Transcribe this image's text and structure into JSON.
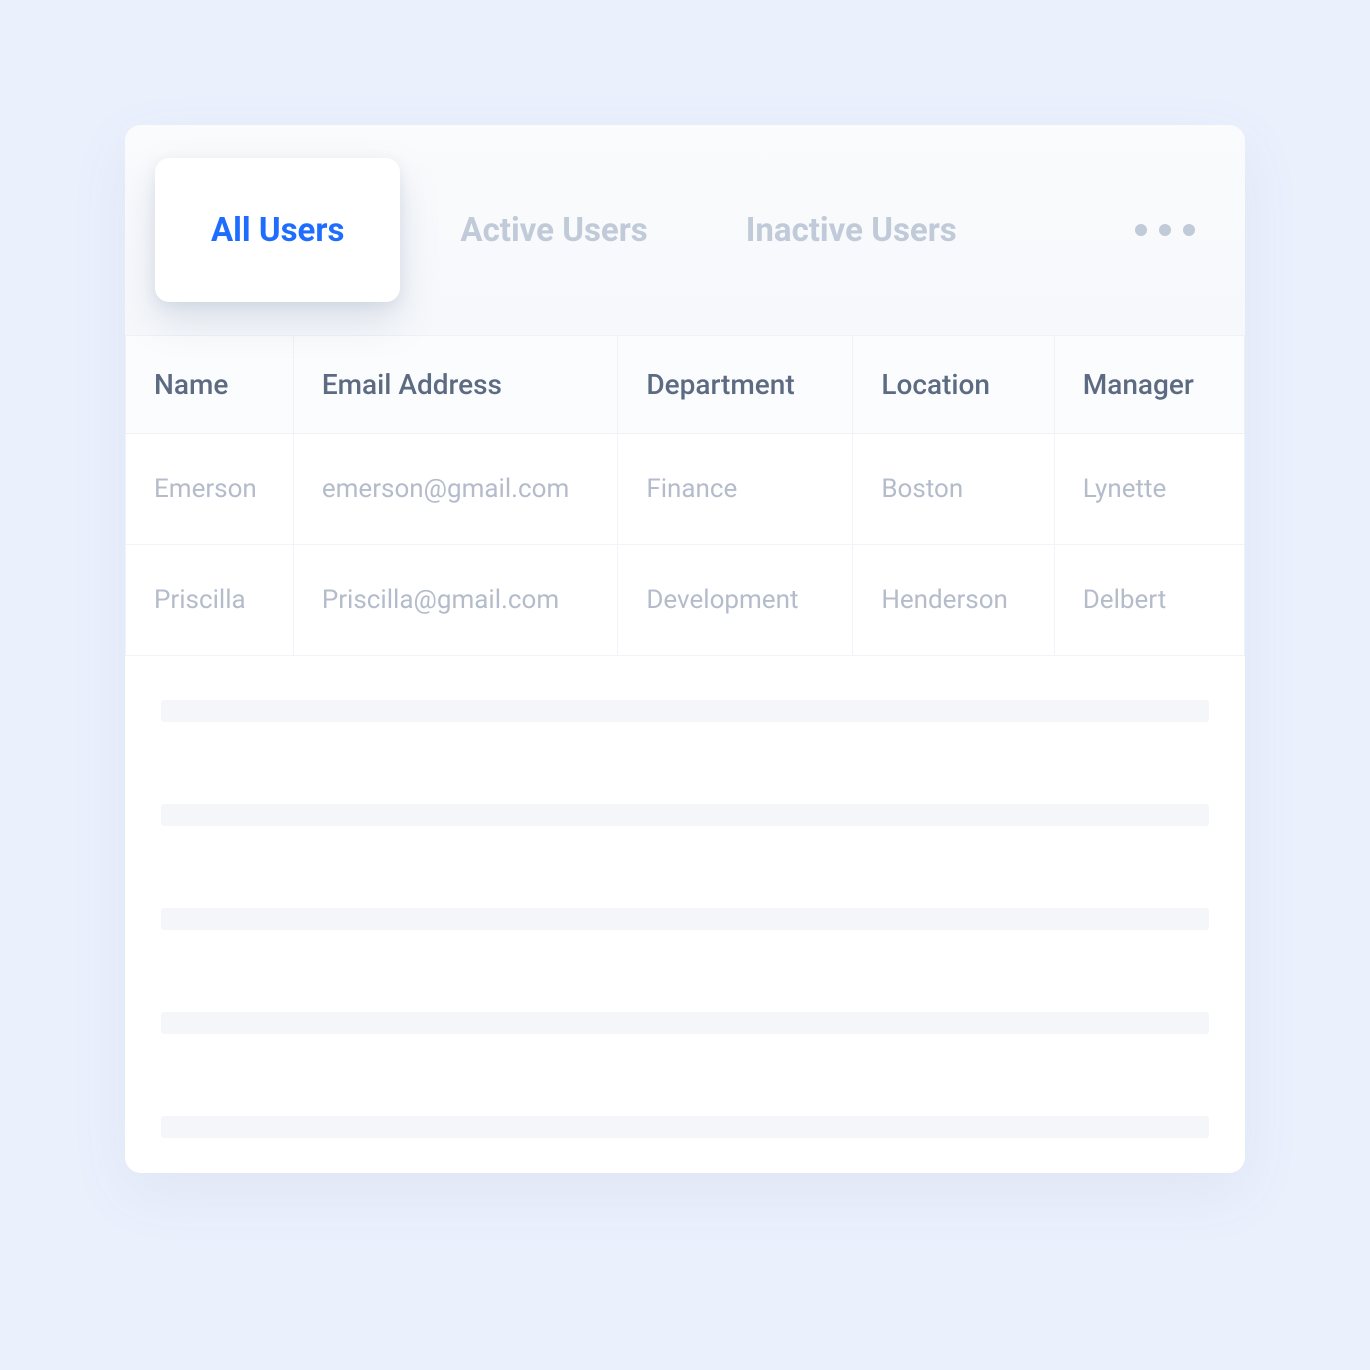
{
  "tabs": {
    "active": "All Users",
    "inactive1": "Active Users",
    "inactive2": "Inactive Users"
  },
  "table": {
    "headers": {
      "name": "Name",
      "email": "Email Address",
      "department": "Department",
      "location": "Location",
      "manager": "Manager"
    },
    "rows": [
      {
        "name": "Emerson",
        "email": "emerson@gmail.com",
        "department": "Finance",
        "location": "Boston",
        "manager": "Lynette"
      },
      {
        "name": "Priscilla",
        "email": "Priscilla@gmail.com",
        "department": "Development",
        "location": "Henderson",
        "manager": "Delbert"
      }
    ]
  }
}
